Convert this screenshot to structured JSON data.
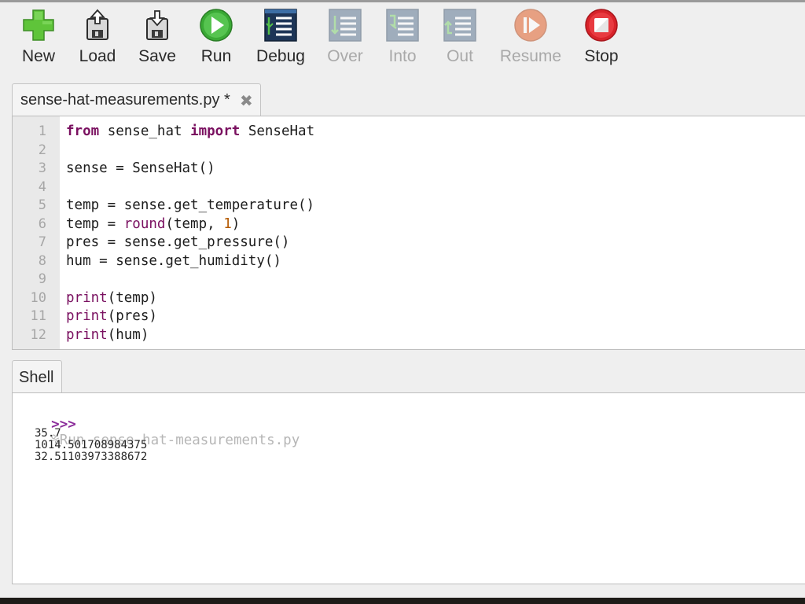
{
  "toolbar": {
    "buttons": [
      {
        "label": "New",
        "icon": "plus-icon",
        "enabled": true
      },
      {
        "label": "Load",
        "icon": "load-icon",
        "enabled": true
      },
      {
        "label": "Save",
        "icon": "save-icon",
        "enabled": true
      },
      {
        "label": "Run",
        "icon": "run-icon",
        "enabled": true
      },
      {
        "label": "Debug",
        "icon": "debug-icon",
        "enabled": true
      },
      {
        "label": "Over",
        "icon": "step-over-icon",
        "enabled": false
      },
      {
        "label": "Into",
        "icon": "step-into-icon",
        "enabled": false
      },
      {
        "label": "Out",
        "icon": "step-out-icon",
        "enabled": false
      },
      {
        "label": "Resume",
        "icon": "resume-icon",
        "enabled": false
      },
      {
        "label": "Stop",
        "icon": "stop-icon",
        "enabled": true
      }
    ]
  },
  "editor": {
    "tab_label": "sense-hat-measurements.py *",
    "close_glyph": "✖",
    "line_numbers": [
      "1",
      "2",
      "3",
      "4",
      "5",
      "6",
      "7",
      "8",
      "9",
      "10",
      "11",
      "12"
    ],
    "lines": [
      {
        "parts": [
          {
            "t": "from",
            "c": "kw"
          },
          {
            "t": " sense_hat ",
            "c": ""
          },
          {
            "t": "import",
            "c": "kw"
          },
          {
            "t": " SenseHat",
            "c": ""
          }
        ]
      },
      {
        "parts": []
      },
      {
        "parts": [
          {
            "t": "sense = SenseHat()",
            "c": ""
          }
        ]
      },
      {
        "parts": []
      },
      {
        "parts": [
          {
            "t": "temp = sense.get_temperature()",
            "c": ""
          }
        ]
      },
      {
        "parts": [
          {
            "t": "temp = ",
            "c": ""
          },
          {
            "t": "round",
            "c": "bi"
          },
          {
            "t": "(temp, ",
            "c": ""
          },
          {
            "t": "1",
            "c": "num"
          },
          {
            "t": ")",
            "c": ""
          }
        ]
      },
      {
        "parts": [
          {
            "t": "pres = sense.get_pressure()",
            "c": ""
          }
        ]
      },
      {
        "parts": [
          {
            "t": "hum = sense.get_humidity()",
            "c": ""
          }
        ]
      },
      {
        "parts": []
      },
      {
        "parts": [
          {
            "t": "print",
            "c": "bi"
          },
          {
            "t": "(temp)",
            "c": ""
          }
        ]
      },
      {
        "parts": [
          {
            "t": "print",
            "c": "bi"
          },
          {
            "t": "(pres)",
            "c": ""
          }
        ]
      },
      {
        "parts": [
          {
            "t": "print",
            "c": "bi"
          },
          {
            "t": "(hum)",
            "c": ""
          }
        ]
      }
    ]
  },
  "shell": {
    "tab_label": "Shell",
    "prompt": ">>>",
    "command": "%Run sense-hat-measurements.py",
    "output": [
      "35.7",
      "1014.501708984375",
      "32.51103973388672"
    ]
  },
  "colors": {
    "keyword": "#7a1060",
    "number": "#b45a00",
    "prompt": "#8b2c9a",
    "run_green": "#3aaa35",
    "stop_red": "#d8232a",
    "new_green": "#5fc43a"
  }
}
